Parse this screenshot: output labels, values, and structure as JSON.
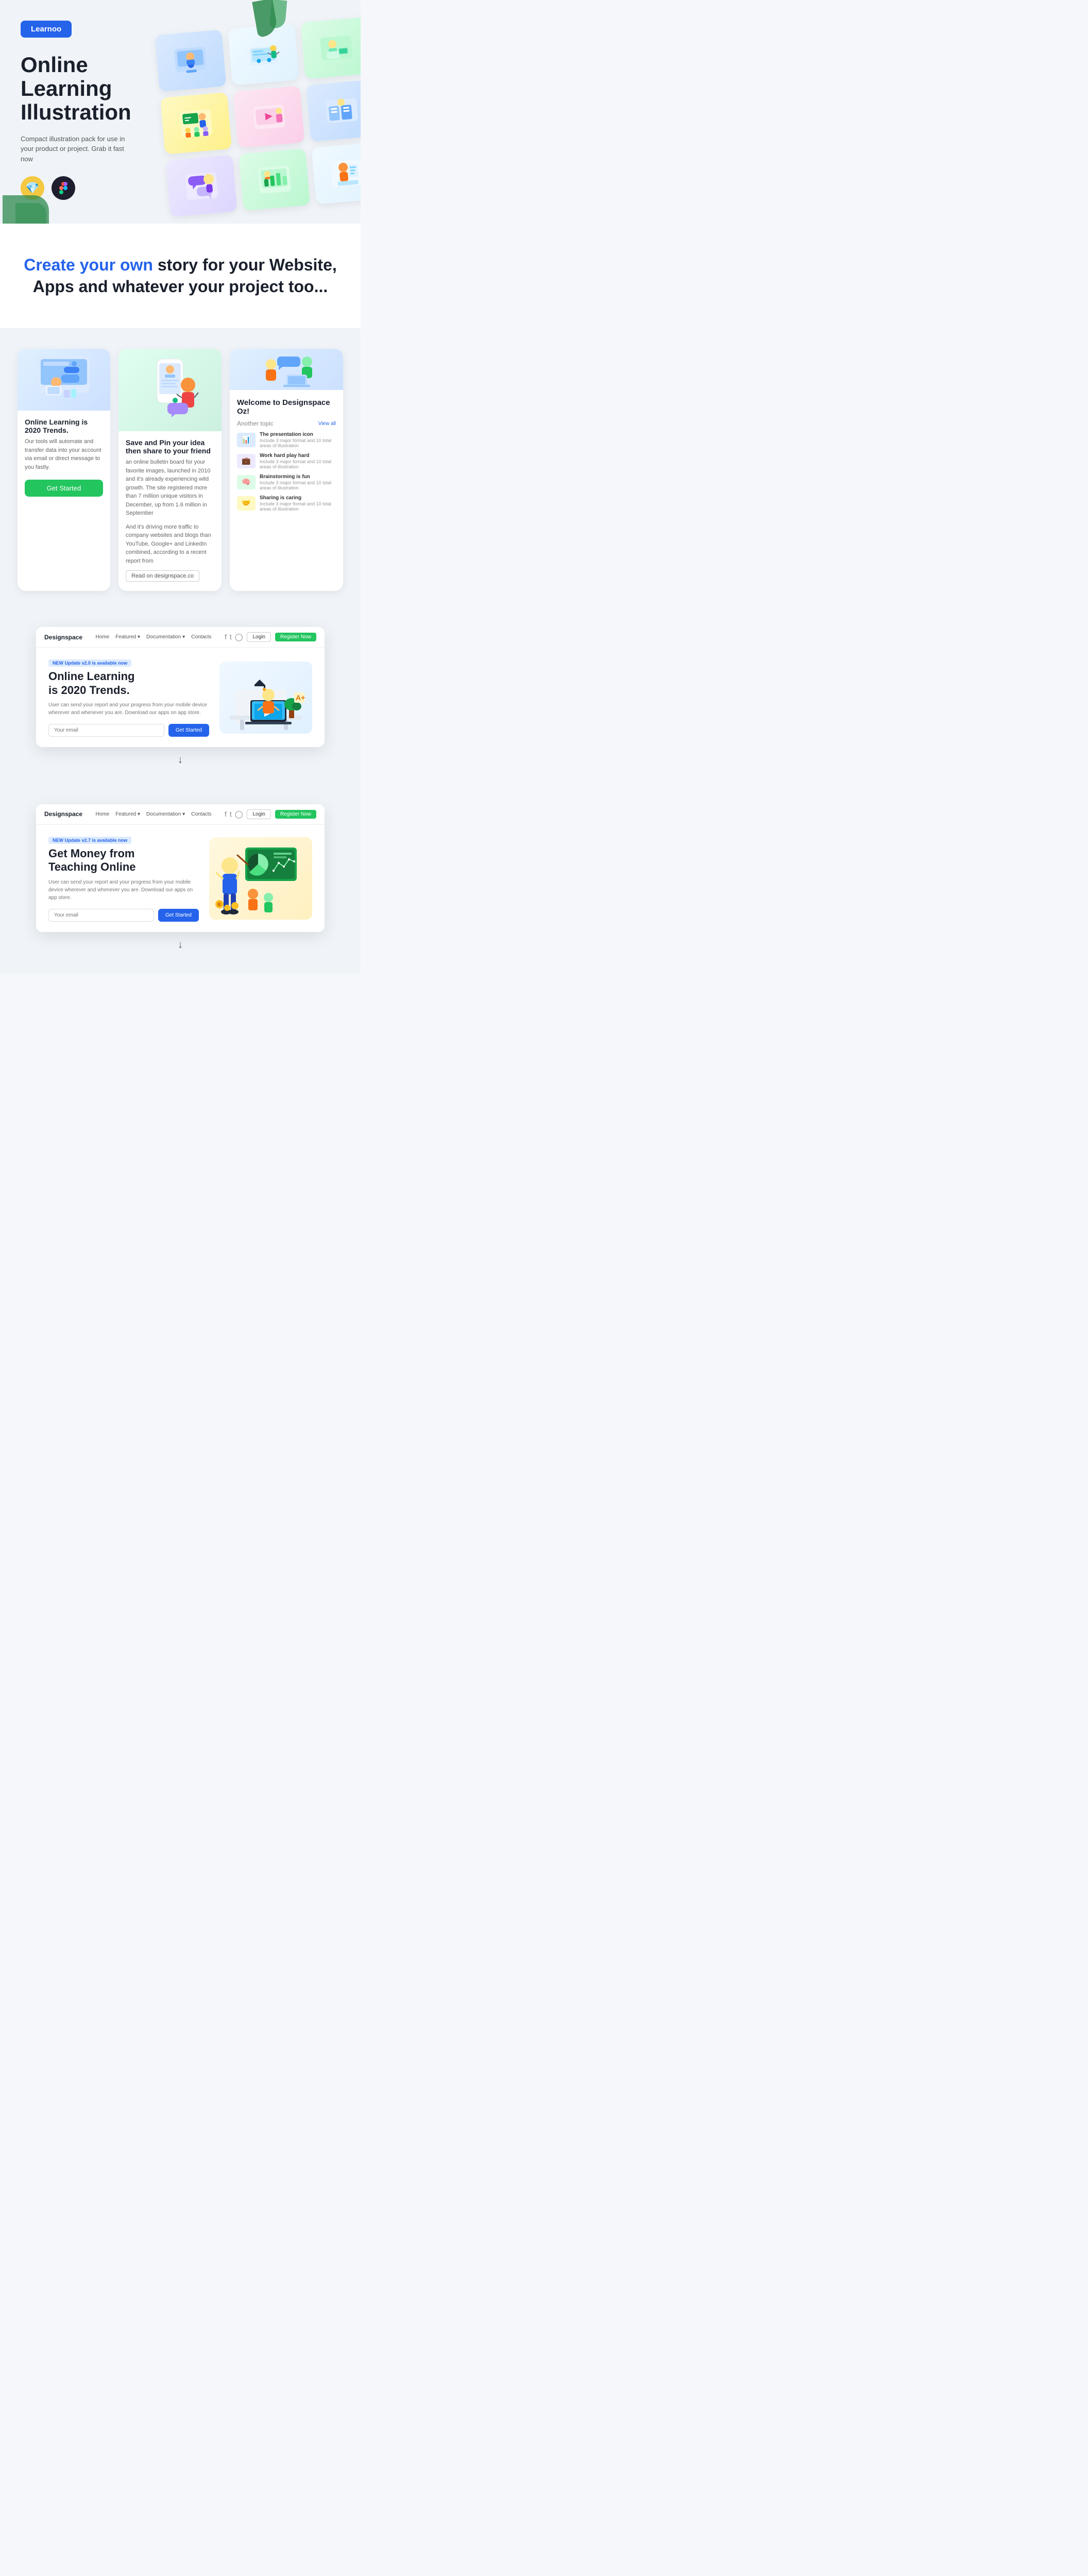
{
  "header": {
    "logo": "Learnoo"
  },
  "hero": {
    "title": "Online Learning Illustration",
    "subtitle": "Compact illustration pack for use in your product or project. Grab it fast now",
    "tools": [
      {
        "name": "Sketch",
        "icon": "💎"
      },
      {
        "name": "Figma",
        "icon": "🎨"
      }
    ],
    "illustrations": [
      "👨‍💻",
      "📊",
      "📚",
      "🎓",
      "💻",
      "📝",
      "👩‍🏫",
      "📈",
      "🖥️"
    ]
  },
  "story": {
    "title_highlight": "Create your own",
    "title_rest": " story for your Website, Apps and whatever your project too..."
  },
  "cards": [
    {
      "type": "app",
      "title": "Online Learning is 2020 Trends.",
      "body": "Our tools will automate and transfer data into your account via email or direct message to you fastly.",
      "cta": "Get Started",
      "icon": "👨‍💻"
    },
    {
      "type": "blog",
      "title": "Save and Pin your idea then share to your friend",
      "body": "an online bulletin board for your favorite images, launched in 2010 and it's already experiencing wild growth. The site registered more than 7 million unique visitors in December, up from 1.6 million in September",
      "body2": "And it's driving more traffic to company websites and blogs than YouTube, Google+ and LinkedIn combined, according to a recent report from",
      "link": "Read on designspace.co",
      "icon": "📌"
    },
    {
      "type": "welcome",
      "welcome_title": "Welcome to Designspace Oz!",
      "another_topic": "Another topic",
      "view_all": "View all",
      "topics": [
        {
          "name": "The presentation icon",
          "sub": "Include 3 major format and 10 total areas of illustration",
          "icon": "📊"
        },
        {
          "name": "Work hard play hard",
          "sub": "Include 3 major format and 10 total areas of illustration",
          "icon": "💼"
        },
        {
          "name": "Brainstorming is fun",
          "sub": "Include 3 major format and 10 total areas of illustration",
          "icon": "🧠"
        },
        {
          "name": "Sharing is caring",
          "sub": "Include 3 major format and 10 total areas of illustration",
          "icon": "🤝"
        }
      ],
      "icon": "👋"
    }
  ],
  "browser1": {
    "logo": "Designspace",
    "menu": [
      "Home",
      "Featured",
      "Documentation",
      "Contacts"
    ],
    "login": "Login",
    "register": "Register Now",
    "badge": "NEW",
    "badge_text": "Update v2.0 is available now",
    "heading_line1": "Online Learning",
    "heading_line2": "is 2020 Trends.",
    "desc": "User can send your report and your progress from your mobile device wherever and whenever you are. Download our apps on app store.",
    "email_placeholder": "Your email",
    "cta": "Get Started",
    "icon": "👩‍💻"
  },
  "arrow1": "↓",
  "browser2": {
    "logo": "Designspace",
    "menu": [
      "Home",
      "Featured",
      "Documentation",
      "Contacts"
    ],
    "login": "Login",
    "register": "Register Now",
    "badge": "NEW",
    "badge_text": "Update v2.7 is available now",
    "heading_line1": "Get Money from",
    "heading_line2": "Teaching Online",
    "desc": "User can send your report and your progress from your mobile device wherever and whenever you are. Download our apps on app store.",
    "email_placeholder": "Your email",
    "cta": "Get Started",
    "icon": "👨‍🏫"
  },
  "arrow2": "↓",
  "presentation_text": "presentation icon Include 3 major format and"
}
